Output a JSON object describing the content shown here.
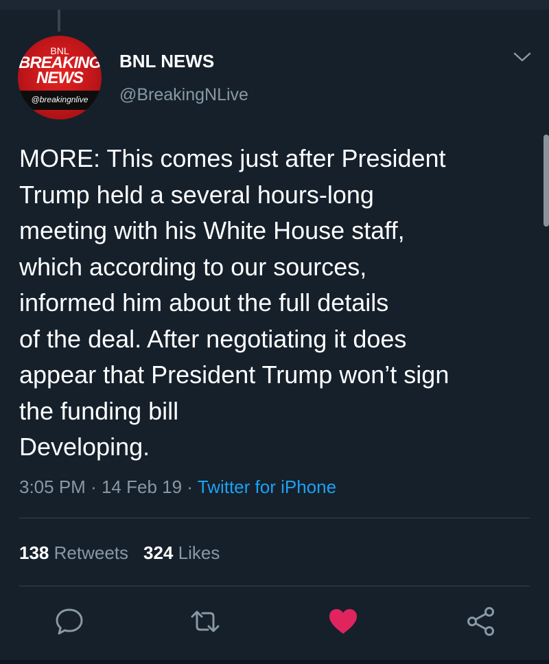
{
  "tweet": {
    "author_name": "BNL NEWS",
    "author_handle": "@BreakingNLive",
    "avatar": {
      "top_text": "BNL",
      "line1": "BREAKING",
      "line2": "NEWS",
      "handle": "@breakingnlive"
    },
    "lines": [
      "MORE: This comes just after President",
      "Trump held a several hours-long",
      "meeting with his White House staff,",
      "which according to our sources,",
      "informed him about the full details",
      "of the deal. After negotiating it does",
      "appear that President Trump won’t sign",
      "the funding bill",
      "Developing."
    ],
    "time": "3:05 PM",
    "date": "14 Feb 19",
    "source": "Twitter for iPhone",
    "separator": "·"
  },
  "stats": {
    "retweets_count": "138",
    "retweets_label": "Retweets",
    "likes_count": "324",
    "likes_label": "Likes"
  },
  "icons": {
    "reply": "reply-icon",
    "retweet": "retweet-icon",
    "like": "heart-icon",
    "share": "share-icon",
    "more": "chevron-down-icon"
  },
  "colors": {
    "background": "#15202b",
    "secondary_text": "#8899a6",
    "link": "#1da1f2",
    "like": "#e0245e"
  }
}
